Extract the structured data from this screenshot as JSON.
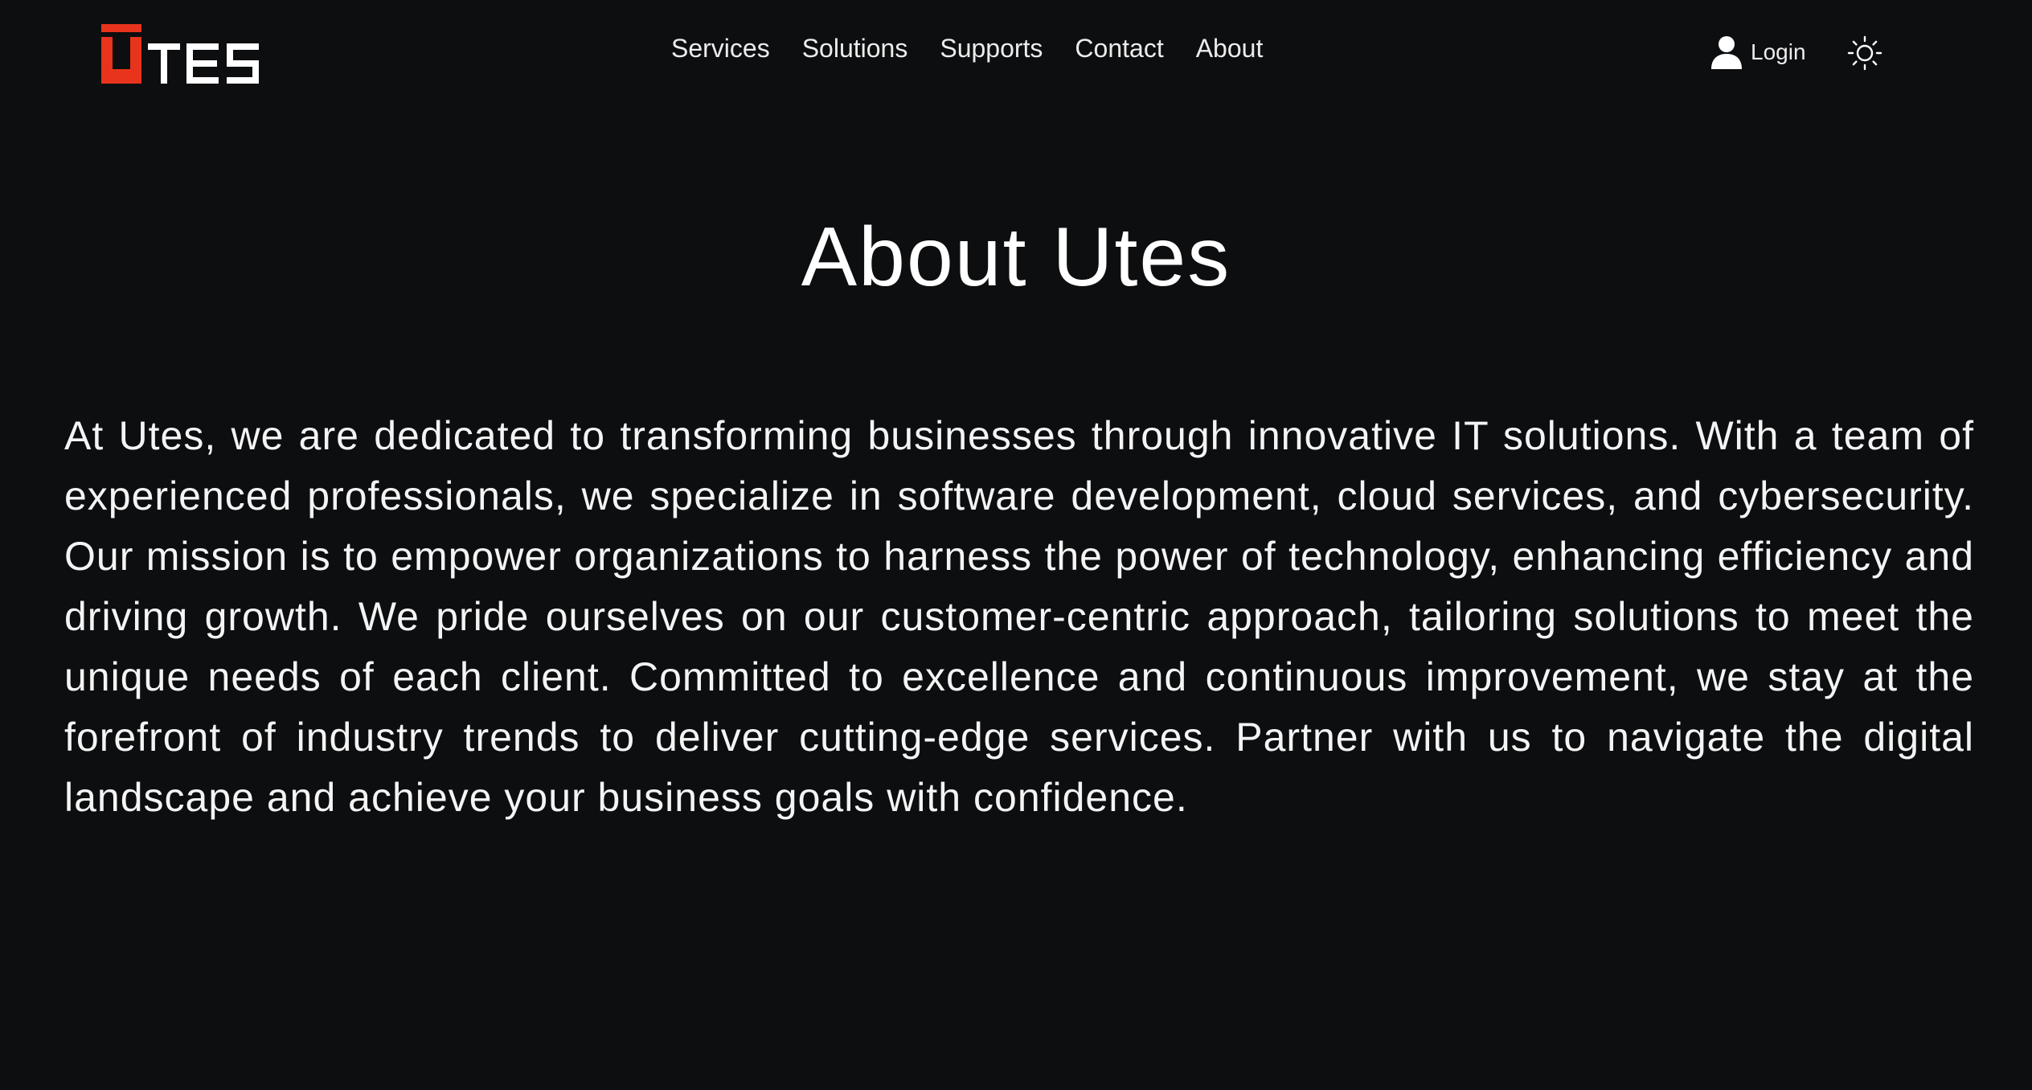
{
  "brand": {
    "logo_text": "UTES",
    "logo_accent_color": "#e8341c",
    "logo_text_color": "#ffffff"
  },
  "nav": {
    "items": [
      {
        "label": "Services"
      },
      {
        "label": "Solutions"
      },
      {
        "label": "Supports"
      },
      {
        "label": "Contact"
      },
      {
        "label": "About"
      }
    ]
  },
  "account": {
    "login_label": "Login",
    "login_icon": "user-icon",
    "theme_icon": "sun-icon"
  },
  "main": {
    "title": "About Utes",
    "body": "At Utes, we are dedicated to transforming businesses through innovative IT solutions. With a team of experienced professionals, we specialize in software development, cloud services, and cybersecurity. Our mission is to empower organizations to harness the power of technology, enhancing efficiency and driving growth. We pride ourselves on our customer-centric approach, tailoring solutions to meet the unique needs of each client. Committed to excellence and continuous improvement, we stay at the forefront of industry trends to deliver cutting-edge services. Partner with us to navigate the digital landscape and achieve your business goals with confidence."
  },
  "colors": {
    "background": "#0d0e10",
    "text": "#f2f2f2",
    "accent": "#e8341c"
  }
}
